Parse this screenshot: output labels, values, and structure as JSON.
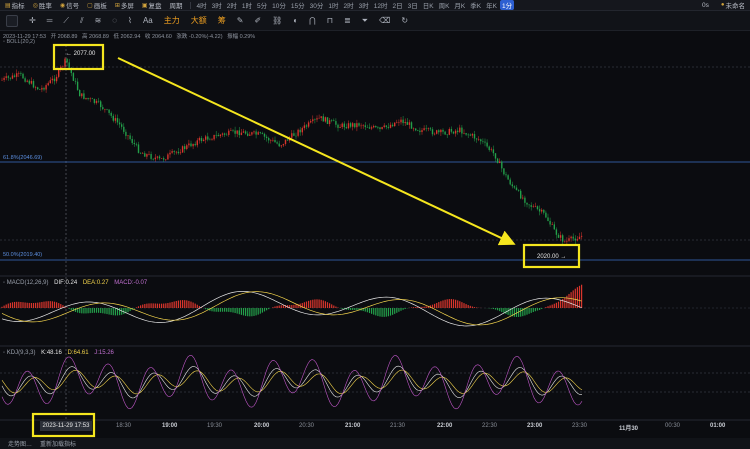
{
  "toolbar": {
    "items": [
      {
        "label": "指标",
        "icon": "indicator-icon"
      },
      {
        "label": "胜率",
        "icon": "winrate-icon"
      },
      {
        "label": "信号",
        "icon": "signal-icon"
      },
      {
        "label": "画板",
        "icon": "draw-board-icon"
      },
      {
        "label": "多屏",
        "icon": "multi-screen-icon"
      },
      {
        "label": "复盘",
        "icon": "replay-icon"
      },
      {
        "label": "周期",
        "icon": "period-icon"
      }
    ],
    "periods": [
      "4时",
      "3时",
      "2时",
      "1时",
      "5分",
      "10分",
      "15分",
      "30分",
      "1时",
      "2时",
      "3时",
      "12时",
      "2日",
      "3日",
      "日K",
      "周K",
      "月K",
      "季K",
      "年K",
      "1分"
    ],
    "active_period": "1分",
    "right": [
      "0s",
      "未命名"
    ]
  },
  "toolbar2": {
    "items": [
      "主力",
      "大额",
      "筹"
    ]
  },
  "info": {
    "date": "2023-11-29 17:53",
    "open": "开 2068.89",
    "high": "高 2068.89",
    "low": "低 2062.94",
    "close": "收 2064.60",
    "change": "涨跌 -0.20%(-4.22)",
    "amp": "振幅 0.29%"
  },
  "boll_label": "BOLL(20,2)",
  "levels": {
    "fib61": "61.8%(2046.69)",
    "fib50": "50.0%(2019.40)"
  },
  "annotations": {
    "high_price": "2077.00",
    "low_price": "2020.00"
  },
  "macd": {
    "name": "MACD(12,26,9)",
    "dif": "DIF:0.24",
    "dea": "DEA:0.27",
    "macd": "MACD:-0.07"
  },
  "kdj": {
    "name": "KDJ(9,3,3)",
    "k": "K:48.16",
    "d": "D:64.61",
    "j": "J:15.26"
  },
  "time_axis": {
    "ticks": [
      "18:30",
      "19:00",
      "19:30",
      "20:00",
      "20:30",
      "21:00",
      "21:30",
      "22:00",
      "22:30",
      "23:00",
      "23:30",
      "11月30",
      "00:30",
      "01:00"
    ],
    "bold_ticks": [
      "19:00",
      "20:00",
      "21:00",
      "22:00",
      "23:00",
      "11月30",
      "01:00"
    ],
    "cursor_time": "2023-11-29 17:53"
  },
  "bottom": {
    "left": "走势图…",
    "text": "重新加载指标"
  },
  "colors": {
    "up": "#d9352c",
    "down": "#23a04a",
    "highlight": "#f5e61e",
    "level": "#3d6fc4"
  }
}
